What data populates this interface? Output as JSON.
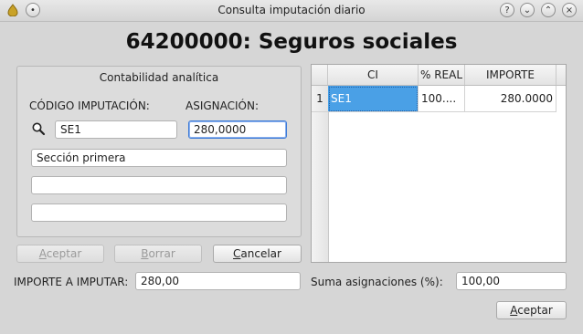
{
  "window": {
    "title": "Consulta imputación diario",
    "controls": [
      "help",
      "minimize",
      "maximize",
      "close"
    ]
  },
  "heading": "64200000: Seguros sociales",
  "panel": {
    "title": "Contabilidad analítica",
    "codigo_label": "CÓDIGO IMPUTACIÓN:",
    "asignacion_label": "ASIGNACIÓN:",
    "codigo_value": "SE1",
    "asignacion_value": "280,0000",
    "seccion_value": "Sección primera",
    "extra1_value": "",
    "extra2_value": "",
    "search_icon": "search-icon"
  },
  "buttons": {
    "aceptar_left": {
      "pre": "",
      "mnemonic": "A",
      "post": "ceptar"
    },
    "borrar": {
      "pre": "",
      "mnemonic": "B",
      "post": "orrar"
    },
    "cancelar": {
      "pre": "",
      "mnemonic": "C",
      "post": "ancelar"
    },
    "aceptar_bottom": {
      "pre": "",
      "mnemonic": "A",
      "post": "ceptar"
    }
  },
  "table": {
    "headers": [
      "CI",
      "% REAL",
      "IMPORTE"
    ],
    "rows": [
      {
        "num": "1",
        "ci": "SE1",
        "real": "100....",
        "importe": "280.0000"
      }
    ]
  },
  "footer": {
    "importe_label": "IMPORTE A IMPUTAR:",
    "importe_value": "280,00",
    "suma_label": "Suma asignaciones (%):",
    "suma_value": "100,00"
  },
  "colors": {
    "selection": "#4aa0e6",
    "focus_border": "#3b7ad8",
    "window_bg": "#d6d6d6"
  }
}
